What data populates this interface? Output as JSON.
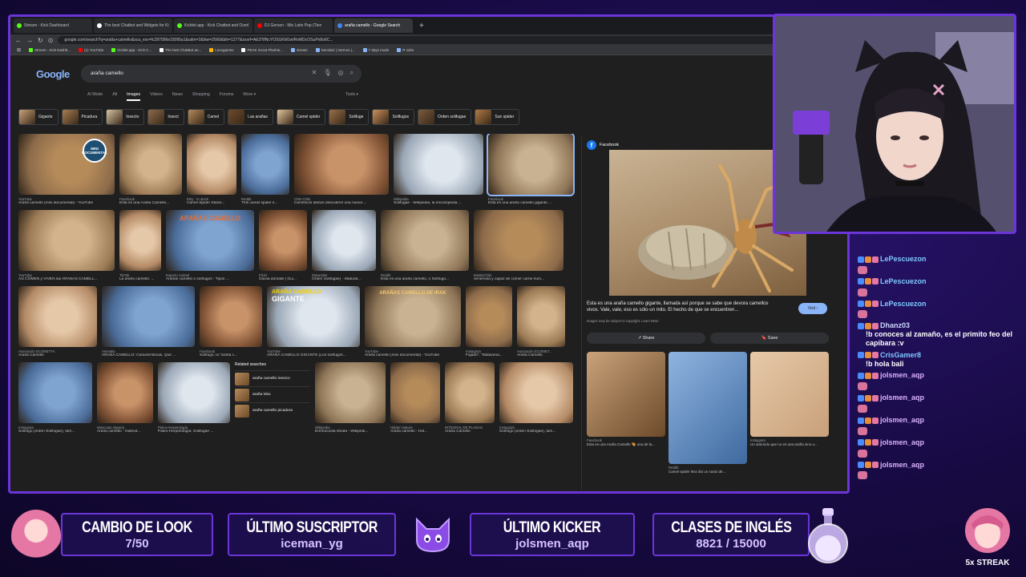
{
  "browser": {
    "tabs": [
      {
        "title": "Stream - Kick Dashboard",
        "color": "#53fc18"
      },
      {
        "title": "The best Chatbot and Widgets for Ki",
        "color": "#ffffff"
      },
      {
        "title": "Kicklet.app - Kick Chatbot and Overl",
        "color": "#53fc18"
      },
      {
        "title": "DJ Gerson - Mix Latin Pop (Tien",
        "color": "#ff0000"
      },
      {
        "title": "araña camello - Google Search",
        "color": "#4285f4"
      }
    ],
    "url": "google.com/search?q=araña+camello&sca_esv=fc287096e33095a1&udm=2&biw=2560&bih=1277&sxsrf=AE3TifNcYOSGKM1wIRnMDcOSuPn8o6C...",
    "bookmarks": [
      {
        "label": "Stream - Kick Dashb...",
        "color": "#53fc18"
      },
      {
        "label": "(1) YouTube",
        "color": "#ff0000"
      },
      {
        "label": "Kicklet.app - Kick C...",
        "color": "#53fc18"
      },
      {
        "label": "The best ChatBot an...",
        "color": "#ffffff"
      },
      {
        "label": "Lexogames",
        "color": "#f4b400"
      },
      {
        "label": "PEAK Scout Plushie...",
        "color": "#ffffff"
      },
      {
        "label": "stream",
        "color": "#8ab4f8"
      },
      {
        "label": "Servidor | Aternos |...",
        "color": "#8ab4f8"
      },
      {
        "label": "7 days mods",
        "color": "#8ab4f8"
      },
      {
        "label": "R subs",
        "color": "#8ab4f8"
      }
    ]
  },
  "google": {
    "logo": "Google",
    "query": "araña camello",
    "tabs": [
      "AI Mode",
      "All",
      "Images",
      "Videos",
      "News",
      "Shopping",
      "Forums",
      "More ▾"
    ],
    "tools": "Tools ▾",
    "chips": [
      "Gigante",
      "Picadura",
      "Insecto",
      "Insect",
      "Camel",
      "Las arañas",
      "Camel spider",
      "Solifuge",
      "Solifugos",
      "Orden solifugae",
      "Sun spider"
    ],
    "rows": [
      [
        {
          "src": "YouTube",
          "cap": "Araña camello (mini documental) - YouTube"
        },
        {
          "src": "Facebook",
          "cap": "Esta es una Araña Camello..."
        },
        {
          "src": "Etsy · In stock",
          "cap": "Camel Spider Sticke..."
        },
        {
          "src": "Reddit",
          "cap": "This camel spider s..."
        },
        {
          "src": "CNN Chile",
          "cap": "Científicos latinos descubren una nueva ..."
        },
        {
          "src": "Wikipedia",
          "cap": "Solifugae - Wikipedia, la enciclopedia ..."
        },
        {
          "src": "Facebook",
          "cap": "Esta es una araña camello gigante ..."
        }
      ],
      [
        {
          "src": "YouTube",
          "cap": "Así COMEN y VIVEN las ARAÑAS CAMELL..."
        },
        {
          "src": "TikTok",
          "cap": "La araña camello: ..."
        },
        {
          "src": "Experto Animal",
          "cap": "Arañas camello o solífugos - Tipos ..."
        },
        {
          "src": "Flickr",
          "cap": "Gluvia dorsalis | Gui..."
        },
        {
          "src": "iNaturalist",
          "cap": "Orden Solifugae) · iNatural..."
        },
        {
          "src": "Reddit",
          "cap": "Esta es una araña camello, o Solífugo..."
        },
        {
          "src": "BioBioChile",
          "cap": "venenosa y capaz de comer carne hum..."
        }
      ],
      [
        {
          "src": "Asociación ECOMETTA",
          "cap": "Araña Camello"
        },
        {
          "src": "Animalia",
          "cap": "ARAÑA CAMELLO: Características, Qué ..."
        },
        {
          "src": "Facebook",
          "cap": "Solífugo, la \"araña c..."
        },
        {
          "src": "YouTube",
          "cap": "ARAÑA CAMELLO GIGANTE (Los solífugos..."
        },
        {
          "src": "YouTube",
          "cap": "Araña camello (mini documental) - YouTube"
        },
        {
          "src": "Instagram",
          "cap": "Fajado\", \"Matavena..."
        },
        {
          "src": "Asociación ECOMET...",
          "cap": "Araña Camello"
        }
      ],
      [
        {
          "src": "Instagram",
          "cap": "Solífugo (orden Solifugae), tam..."
        },
        {
          "src": "Mascotas Algama",
          "cap": "Araña camello - Galeod..."
        },
        {
          "src": "Paleo-Herpetología",
          "cap": "Paleo-Herpetología: Solifugae ..."
        },
        {
          "src": "Wikipedia",
          "cap": "Eremocosta striata - Wikipedi..."
        },
        {
          "src": "Hidden Nature",
          "cap": "Araña camello - Hid..."
        },
        {
          "src": "INTEGRAL DE PLAGAS",
          "cap": "Araña Camello"
        },
        {
          "src": "Instagram",
          "cap": "Solífugo (orden Solifugae), tam..."
        }
      ]
    ],
    "overlay_labels": {
      "mini": "MINI DOCUMENTAL",
      "aranas": "ARAÑAS CAMELLO",
      "gigante1": "ARAÑA CAMELLO",
      "gigante2": "GIGANTE",
      "arañas_irak": "ARAÑAS CAMELLO DE IRAK"
    },
    "related": {
      "title": "Related searches",
      "items": [
        "araña camello mexico",
        "araña lobo",
        "araña camello picadura"
      ]
    },
    "preview": {
      "source": "Facebook",
      "caption": "Esta es una araña camello gigante, llamada así porque se sabe que devora camellos vivos. Vale, vale, eso es sólo un mito. El hecho de que se encuentren...",
      "note": "Images may be subject to copyright. Learn More",
      "visit": "Visit ›",
      "share": "Share",
      "save": "Save",
      "thumbs": [
        {
          "src": "Facebook",
          "cap": "Esta es una Araña Camello 🐪 una de la..."
        },
        {
          "src": "Reddit",
          "cap": "Camel spider less dio un susto de..."
        },
        {
          "src": "Instagram",
          "cap": "Un arácnido que no es una araña sino u..."
        }
      ]
    }
  },
  "chat": [
    {
      "user": "LePescuezon",
      "text": "",
      "emote": true,
      "color": "#7fc8ff"
    },
    {
      "user": "LePescuezon",
      "text": "",
      "emote": true,
      "color": "#7fc8ff"
    },
    {
      "user": "LePescuezon",
      "text": "",
      "emote": true,
      "color": "#7fc8ff"
    },
    {
      "user": "Dhanz03",
      "text": "!b conoces al zamaño, es el primito feo del capibara :v",
      "emote": false,
      "color": "#cfd8ff"
    },
    {
      "user": "CrisGamer8",
      "text": "!b hola bali",
      "emote": false,
      "color": "#7fc8ff"
    },
    {
      "user": "jolsmen_aqp",
      "text": "",
      "emote": true,
      "color": "#d9b2ff"
    },
    {
      "user": "jolsmen_aqp",
      "text": "",
      "emote": true,
      "color": "#d9b2ff"
    },
    {
      "user": "jolsmen_aqp",
      "text": "",
      "emote": true,
      "color": "#d9b2ff"
    },
    {
      "user": "jolsmen_aqp",
      "text": "",
      "emote": true,
      "color": "#d9b2ff"
    },
    {
      "user": "jolsmen_aqp",
      "text": "",
      "emote": true,
      "color": "#d9b2ff"
    }
  ],
  "overlay": {
    "look": {
      "title": "CAMBIO DE LOOK",
      "value": "7/50"
    },
    "sub": {
      "title": "ÚLTIMO SUSCRIPTOR",
      "value": "iceman_yg"
    },
    "kicker": {
      "title": "ÚLTIMO KICKER",
      "value": "jolsmen_aqp"
    },
    "english": {
      "title": "CLASES DE INGLÉS",
      "value": "8821 / 15000"
    },
    "streak": "5x STREAK"
  },
  "colors": {
    "accent": "#6b35d8",
    "background": "#160a3c"
  }
}
